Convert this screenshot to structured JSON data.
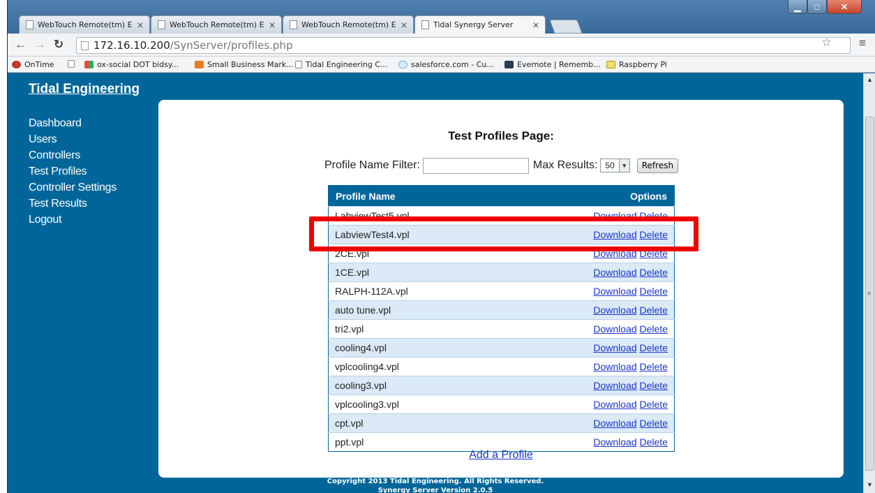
{
  "browser": {
    "tabs": [
      {
        "title": "WebTouch Remote(tm) E"
      },
      {
        "title": "WebTouch Remote(tm) E"
      },
      {
        "title": "WebTouch Remote(tm) E"
      },
      {
        "title": "Tidal Synergy Server"
      }
    ],
    "tab_close_glyph": "×",
    "url_host": "172.16.10.200",
    "url_path": "/SynServer/profiles.php",
    "bookmarks": [
      {
        "label": "OnTime",
        "icon": "ontime-icon"
      },
      {
        "label": "",
        "icon": "page-icon"
      },
      {
        "label": "ox-social DOT bidsy...",
        "icon": "grid-icon"
      },
      {
        "label": "Small Business Mark...",
        "icon": "bird-icon"
      },
      {
        "label": "Tidal Engineering C...",
        "icon": "page-icon"
      },
      {
        "label": "salesforce.com - Cu...",
        "icon": "cloud-icon"
      },
      {
        "label": "Evernote | Rememb...",
        "icon": "evernote-icon"
      },
      {
        "label": "Raspberry Pi",
        "icon": "folder-icon"
      }
    ]
  },
  "site": {
    "brand": "Tidal Engineering",
    "nav": [
      "Dashboard",
      "Users",
      "Controllers",
      "Test Profiles",
      "Controller Settings",
      "Test Results",
      "Logout"
    ]
  },
  "page": {
    "heading": "Test Profiles Page:",
    "filter_label": "Profile Name Filter:",
    "filter_value": "",
    "max_results_label": "Max Results:",
    "max_results_value": "50",
    "refresh_label": "Refresh",
    "table_headers": {
      "name": "Profile Name",
      "options": "Options"
    },
    "download_label": "Download",
    "delete_label": "Delete",
    "profiles": [
      "LabviewTest5.vpl",
      "LabviewTest4.vpl",
      "2CE.vpl",
      "1CE.vpl",
      "RALPH-112A.vpl",
      "auto tune.vpl",
      "tri2.vpl",
      "cooling4.vpl",
      "vplcooling4.vpl",
      "cooling3.vpl",
      "vplcooling3.vpl",
      "cpt.vpl",
      "ppt.vpl"
    ],
    "highlighted_profile": "LabviewTest4.vpl",
    "add_profile_label": "Add a Profile",
    "footer_copyright": "Copyright 2013 Tidal Engineering. All Rights Reserved.",
    "footer_version": "Synergy Server Version 2.0.5"
  },
  "colors": {
    "site_blue": "#006699",
    "highlight_red": "#ee0000",
    "link_blue": "#1b35c8"
  }
}
